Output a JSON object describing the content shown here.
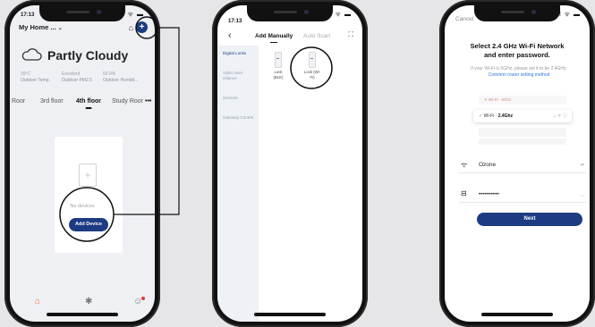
{
  "phone1": {
    "status_time": "17:13",
    "status_icons": "..ıl ᯤ ▬",
    "home_selector": "My Home ...",
    "home_chevron": "⌄",
    "scene_icon": "⌂",
    "add_icon": "+",
    "weather_condition": "Partly Cloudy",
    "stats": [
      {
        "value": "39°C",
        "label": "Outdoor Temp."
      },
      {
        "value": "Excellent",
        "label": "Outdoor PM2.5"
      },
      {
        "value": "50.0%",
        "label": "Outdoor Humidi..."
      }
    ],
    "rooms": [
      "Roor",
      "3rd floor",
      "4th floor",
      "Study Roor"
    ],
    "rooms_more": "•••",
    "doc_glyph": "+",
    "empty_text": "No devices",
    "add_device_label": "Add Device",
    "tabs": {
      "home": "⌂",
      "scene": "✱",
      "me": "☺"
    }
  },
  "phone2": {
    "status_time": "17:13",
    "status_icons": "..ıl ᯤ ▬",
    "back_icon": "‹",
    "tabs": [
      "Add Manually",
      "Auto Scan"
    ],
    "scan_icon": "⛶",
    "categories": [
      "Digital Locks",
      "Video Surv eillance",
      "Sensors",
      "Gateway Control"
    ],
    "devices": [
      {
        "label": "Lock (BLE)"
      },
      {
        "label": "Lock (Wi-Fi)"
      }
    ]
  },
  "phone3": {
    "cancel_label": "Cancel",
    "status_icons": "..ıl ᯤ ▬",
    "title_line1": "Select 2.4 GHz Wi-Fi Network",
    "title_line2": "and enter password.",
    "sub_text": "If your Wi-Fi is 5GHz, please set it to be 2.4GHz.",
    "sub_link": "Common router setting method",
    "wifi_5g": "✕ Wi-Fi · 5Ghz",
    "wifi_24_check": "✓",
    "wifi_24_prefix": "Wi-Fi ·",
    "wifi_24_name": "2.4Ghz",
    "wifi_24_right": "⌂ ᯤ ⓘ",
    "ssid_icon": "ᯤ",
    "ssid_value": "Ozone",
    "ssid_right": "⇄",
    "pass_icon": "⊟",
    "pass_value": "••••••••••",
    "pass_right": "◡",
    "next_label": "Next"
  }
}
